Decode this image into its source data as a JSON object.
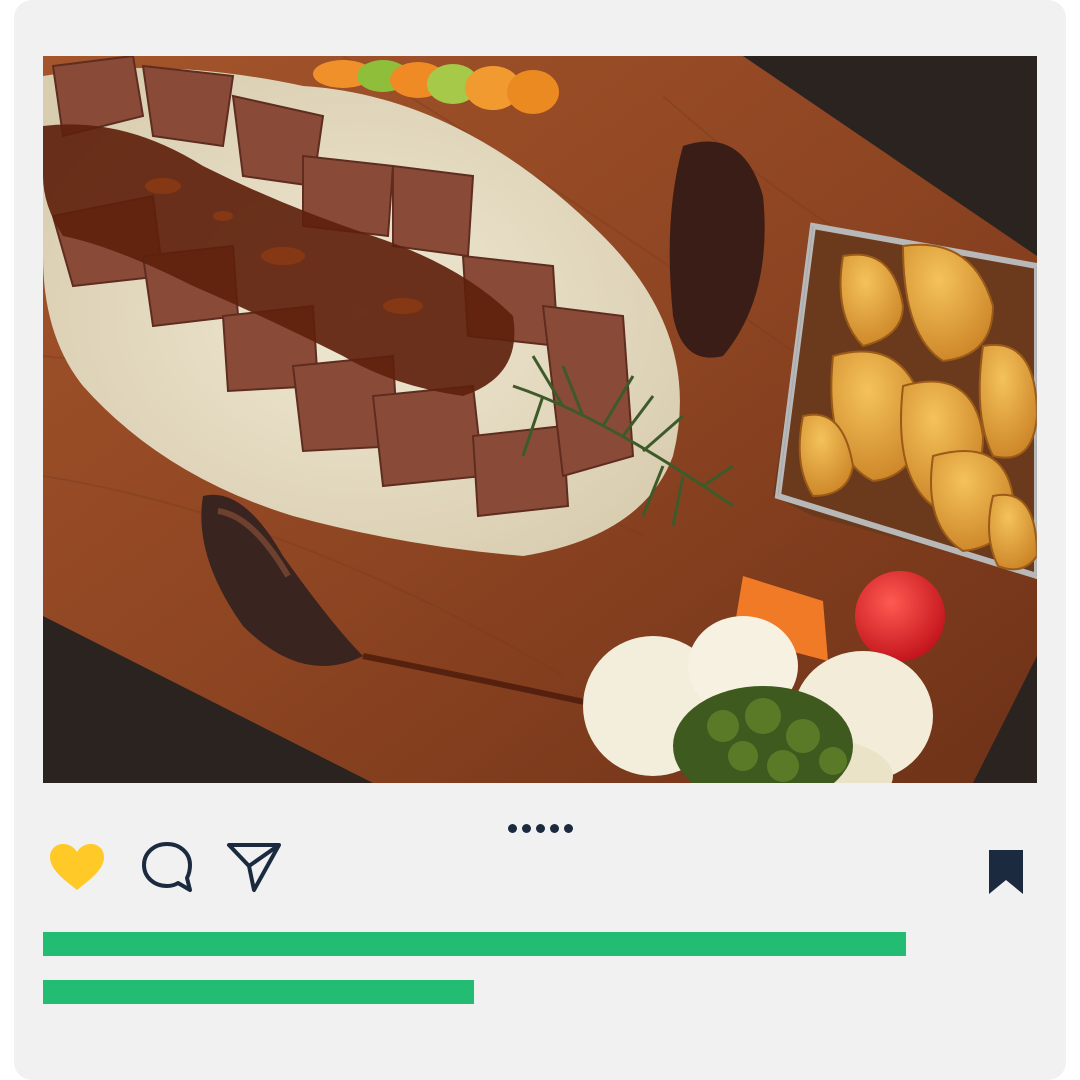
{
  "post": {
    "image": {
      "subject": "food-platter-photo"
    },
    "carousel": {
      "count": 5,
      "active": 0
    },
    "actions": {
      "like": {
        "icon": "heart-icon",
        "liked": true,
        "color": "#ffc928"
      },
      "comment": {
        "icon": "comment-icon"
      },
      "share": {
        "icon": "send-icon"
      },
      "save": {
        "icon": "bookmark-icon",
        "saved": true
      }
    },
    "caption_lines": [
      {
        "fill": 0.868,
        "color": "#22bd73"
      },
      {
        "fill": 0.434,
        "color": "#22bd73"
      }
    ]
  },
  "colors": {
    "card": "#f1f1f1",
    "icon": "#1b2a3f",
    "accent": "#22bd73",
    "heart": "#ffc928"
  }
}
